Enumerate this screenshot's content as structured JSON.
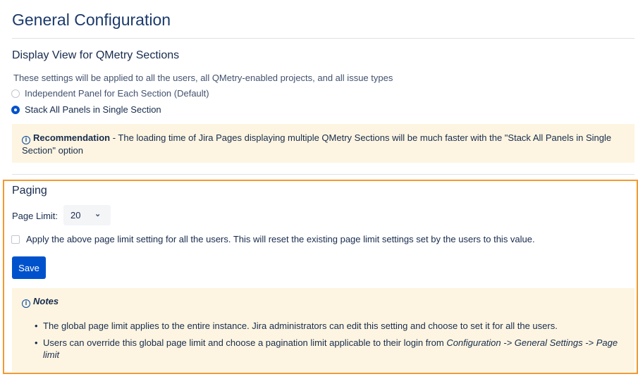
{
  "page": {
    "title": "General Configuration"
  },
  "display_view": {
    "title": "Display View for QMetry Sections",
    "description": "These settings will be applied to all the users, all QMetry-enabled projects, and all issue types",
    "options": [
      {
        "label": "Independent Panel for Each Section (Default)",
        "selected": false
      },
      {
        "label": "Stack All Panels in Single Section",
        "selected": true
      }
    ],
    "recommendation": {
      "icon": "info-icon",
      "heading": "Recommendation",
      "text_line1": " - The loading time of Jira Pages displaying multiple QMetry Sections will be much faster with the \"Stack All Panels in Single",
      "text_line2": "Section\" option"
    }
  },
  "paging": {
    "title": "Paging",
    "page_limit_label": "Page Limit:",
    "page_limit_value": "20",
    "apply_all_label": "Apply the above page limit setting for all the users. This will reset the existing page limit settings set by the users to this value.",
    "apply_all_checked": false,
    "save_label": "Save",
    "notes": {
      "icon": "info-icon",
      "title": "Notes",
      "items": [
        "The global page limit applies to the entire instance. Jira administrators can edit this setting and choose to set it for all the users."
      ],
      "item2_prefix": "Users can override this global page limit and choose a pagination limit applicable to their login from ",
      "item2_path_line1": "Configuration -> General Settings -> Page",
      "item2_path_line2": "limit"
    }
  },
  "colors": {
    "primary": "#0052cc",
    "highlight_border": "#f29a30",
    "note_background": "#fdf5e1"
  }
}
